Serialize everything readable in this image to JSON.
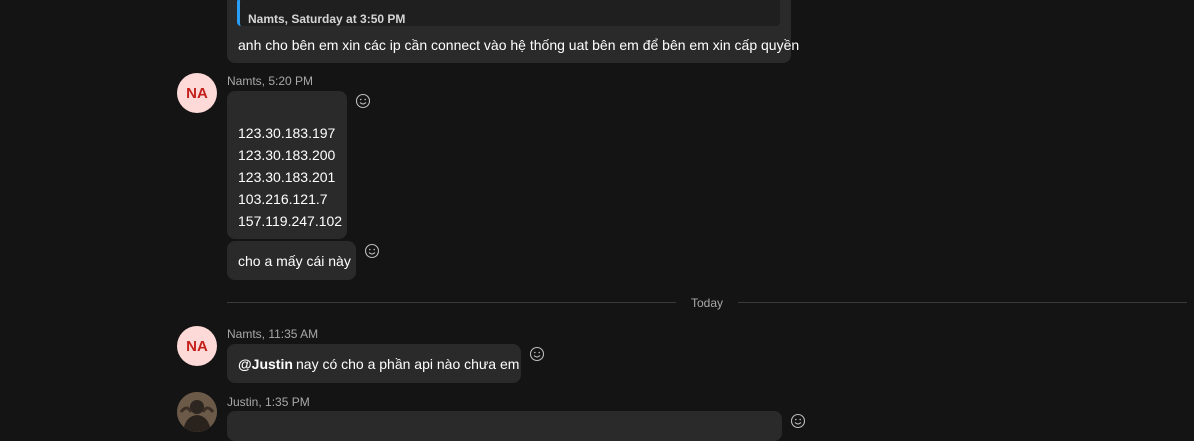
{
  "messages": {
    "quoted_block": {
      "quote_meta": "Namts, Saturday at 3:50 PM",
      "text": "anh cho bên em xin các ip cần connect vào hệ thống uat bên em để bên em xin cấp quyền"
    },
    "group1": {
      "avatar_initials": "NA",
      "meta": "Namts, 5:20 PM",
      "ip_list": [
        "123.30.183.197",
        "123.30.183.200",
        "123.30.183.201",
        "103.216.121.7",
        "157.119.247.102"
      ],
      "followup": "cho a mấy cái này"
    },
    "divider_label": "Today",
    "group2": {
      "avatar_initials": "NA",
      "meta": "Namts, 11:35 AM",
      "mention": "@Justin",
      "text": "nay có cho a phần api nào chưa em"
    },
    "group3": {
      "meta": "Justin, 1:35 PM"
    }
  },
  "icons": {
    "reaction": "smiley-face-icon",
    "avatar_photo": "user-photo-avatar"
  },
  "colors": {
    "background": "#141414",
    "bubble": "#2a2a2a",
    "quote_accent": "#2a9df4",
    "avatar_bg": "#fdd9d7",
    "avatar_text": "#c4201b"
  }
}
